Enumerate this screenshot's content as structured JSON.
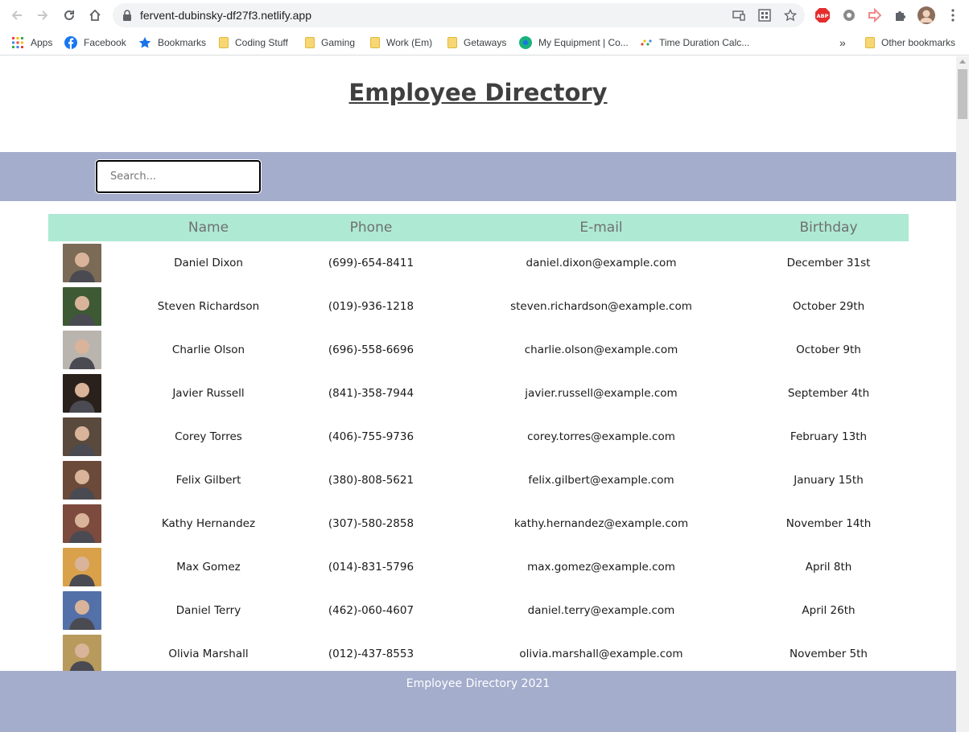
{
  "browser": {
    "url": "fervent-dubinsky-df27f3.netlify.app",
    "bookmarks": [
      {
        "label": "Apps",
        "icon": "apps-grid-icon"
      },
      {
        "label": "Facebook",
        "icon": "facebook-icon"
      },
      {
        "label": "Bookmarks",
        "icon": "star-icon"
      },
      {
        "label": "Coding Stuff",
        "icon": "folder-icon"
      },
      {
        "label": "Gaming",
        "icon": "folder-icon"
      },
      {
        "label": "Work (Em)",
        "icon": "folder-icon"
      },
      {
        "label": "Getaways",
        "icon": "folder-icon"
      },
      {
        "label": "My Equipment | Co...",
        "icon": "site-icon"
      },
      {
        "label": "Time Duration Calc...",
        "icon": "site-icon"
      }
    ],
    "overflow_label": "»",
    "other_bookmarks": "Other bookmarks",
    "accent_color": "#1a73e8"
  },
  "page": {
    "title": "Employee Directory",
    "search": {
      "placeholder": "Search...",
      "value": ""
    },
    "columns": [
      "",
      "Name",
      "Phone",
      "E-mail",
      "Birthday"
    ],
    "employees": [
      {
        "name": "Daniel Dixon",
        "phone": "(699)-654-8411",
        "email": "daniel.dixon@example.com",
        "birthday": "December 31st",
        "avatar_color": "#7a6a56"
      },
      {
        "name": "Steven Richardson",
        "phone": "(019)-936-1218",
        "email": "steven.richardson@example.com",
        "birthday": "October 29th",
        "avatar_color": "#3e5a35"
      },
      {
        "name": "Charlie Olson",
        "phone": "(696)-558-6696",
        "email": "charlie.olson@example.com",
        "birthday": "October 9th",
        "avatar_color": "#b9b4ae"
      },
      {
        "name": "Javier Russell",
        "phone": "(841)-358-7944",
        "email": "javier.russell@example.com",
        "birthday": "September 4th",
        "avatar_color": "#2a211c"
      },
      {
        "name": "Corey Torres",
        "phone": "(406)-755-9736",
        "email": "corey.torres@example.com",
        "birthday": "February 13th",
        "avatar_color": "#5a4a3d"
      },
      {
        "name": "Felix Gilbert",
        "phone": "(380)-808-5621",
        "email": "felix.gilbert@example.com",
        "birthday": "January 15th",
        "avatar_color": "#6b4a3a"
      },
      {
        "name": "Kathy Hernandez",
        "phone": "(307)-580-2858",
        "email": "kathy.hernandez@example.com",
        "birthday": "November 14th",
        "avatar_color": "#7d4a3e"
      },
      {
        "name": "Max Gomez",
        "phone": "(014)-831-5796",
        "email": "max.gomez@example.com",
        "birthday": "April 8th",
        "avatar_color": "#d9a14a"
      },
      {
        "name": "Daniel Terry",
        "phone": "(462)-060-4607",
        "email": "daniel.terry@example.com",
        "birthday": "April 26th",
        "avatar_color": "#5470a8"
      },
      {
        "name": "Olivia Marshall",
        "phone": "(012)-437-8553",
        "email": "olivia.marshall@example.com",
        "birthday": "November 5th",
        "avatar_color": "#b89a5c"
      }
    ],
    "footer": "Employee Directory 2021",
    "colors": {
      "band": "#a4adcc",
      "table_header": "#aee9d4",
      "title": "#3f3f3f"
    }
  }
}
